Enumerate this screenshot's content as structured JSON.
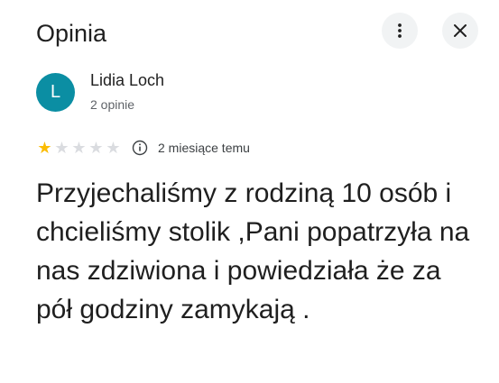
{
  "header": {
    "title": "Opinia",
    "more_icon": "more-vert-icon",
    "close_icon": "close-icon"
  },
  "author": {
    "avatar_letter": "L",
    "avatar_color": "#0b8ea3",
    "name": "Lidia Loch",
    "review_count": "2 opinie"
  },
  "rating": {
    "value": 1,
    "max": 5,
    "filled_color": "#fbbc04",
    "empty_color": "#dadce0",
    "info_icon": "info-icon",
    "timestamp": "2 miesiące temu"
  },
  "review": {
    "text": "Przyjechaliśmy z rodziną 10 osób i chcieliśmy stolik ,Pani popatrzyła na nas zdziwiona i powiedziała że za pół godziny zamykają ."
  }
}
